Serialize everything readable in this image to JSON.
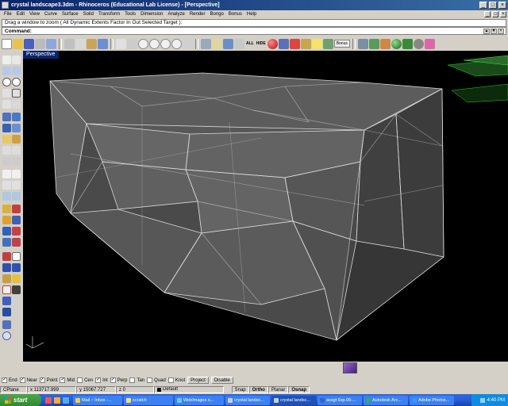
{
  "window": {
    "title": "crystal landscape3.3dm - Rhinoceros (Educational Lab License) - [Perspective]",
    "controls": [
      "_",
      "□",
      "×"
    ]
  },
  "menu": {
    "items": [
      "File",
      "Edit",
      "View",
      "Curve",
      "Surface",
      "Solid",
      "Transform",
      "Tools",
      "Dimension",
      "Analyze",
      "Render",
      "Bongo",
      "Bonus",
      "Help"
    ],
    "doc_controls": [
      "_",
      "□",
      "×"
    ]
  },
  "command": {
    "history": "Drag a window to zoom ( All  Dynamic  Extents  Factor  In  Out  Selected  Target ):",
    "label": "Command:",
    "value": ""
  },
  "toolbar": {
    "all_label": "ALL",
    "hide_label": "HIDE",
    "bonus_label": "Bonus"
  },
  "viewport": {
    "tab_label": "Perspective"
  },
  "osnap": {
    "items": [
      {
        "label": "End",
        "checked": true
      },
      {
        "label": "Near",
        "checked": true
      },
      {
        "label": "Point",
        "checked": true
      },
      {
        "label": "Mid",
        "checked": true
      },
      {
        "label": "Cen",
        "checked": false
      },
      {
        "label": "Int",
        "checked": true
      },
      {
        "label": "Perp",
        "checked": true
      },
      {
        "label": "Tan",
        "checked": false
      },
      {
        "label": "Quad",
        "checked": false
      },
      {
        "label": "Knot",
        "checked": false
      }
    ],
    "project_label": "Project",
    "disable_label": "Disable"
  },
  "status": {
    "cplane": "CPlane",
    "x": "x 113717.999",
    "y": "y 15067.727",
    "z": "z 0",
    "layer": "Default",
    "snap": "Snap",
    "ortho": "Ortho",
    "planar": "Planar",
    "osnap": "Osnap"
  },
  "taskbar": {
    "start_label": "start",
    "tasks": [
      {
        "label": "Mail :: Inbox -...",
        "active": false
      },
      {
        "label": "scratch",
        "active": false
      },
      {
        "label": "WebImages o...",
        "active": false
      },
      {
        "label": "crystal landsc...",
        "active": false
      },
      {
        "label": "crystal landsc...",
        "active": true
      },
      {
        "label": "assgt 6sp.06-...",
        "active": false
      },
      {
        "label": "Autodesk Arc...",
        "active": false
      },
      {
        "label": "Adobe Photos...",
        "active": false
      }
    ],
    "clock": "4:40 PM"
  },
  "colors": {
    "title_bar": "#0a246a",
    "viewport_bg": "#000000",
    "model_faces": "#8a8a8a",
    "highlight_green": "#33cc33"
  }
}
